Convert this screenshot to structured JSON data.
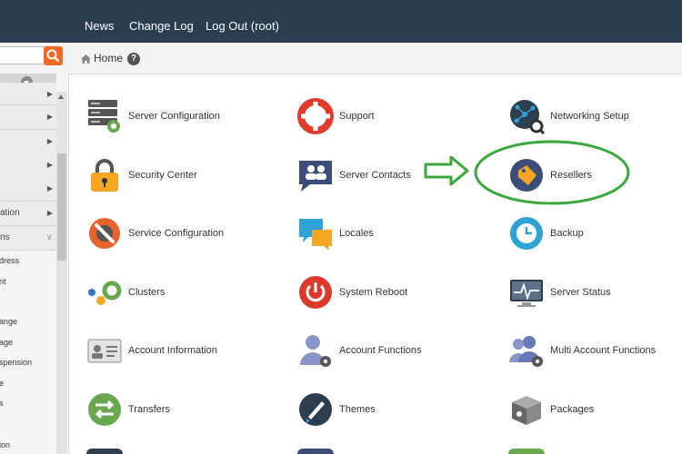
{
  "topnav": {
    "news": "News",
    "changelog": "Change Log",
    "logout": "Log Out (root)"
  },
  "search": {
    "value": "",
    "placeholder": ""
  },
  "breadcrumb": {
    "home": "Home",
    "help": "?"
  },
  "sidebar": {
    "items": [
      "dress",
      "nt",
      "ange",
      "age",
      "spension",
      "e",
      "s",
      "ion"
    ],
    "categories": [
      "",
      "",
      "",
      "",
      "",
      "ation",
      "ns"
    ]
  },
  "grid": {
    "col1": [
      "Server Configuration",
      "Security Center",
      "Service Configuration",
      "Clusters",
      "Account Information",
      "Transfers"
    ],
    "col2": [
      "Support",
      "Server Contacts",
      "Locales",
      "System Reboot",
      "Account Functions",
      "Themes"
    ],
    "col3": [
      "Networking Setup",
      "Resellers",
      "Backup",
      "Server Status",
      "Multi Account Functions",
      "Packages"
    ]
  },
  "colors": {
    "topbar": "#2b3e50",
    "accent": "#f26722",
    "annotation": "#3aa83a"
  }
}
